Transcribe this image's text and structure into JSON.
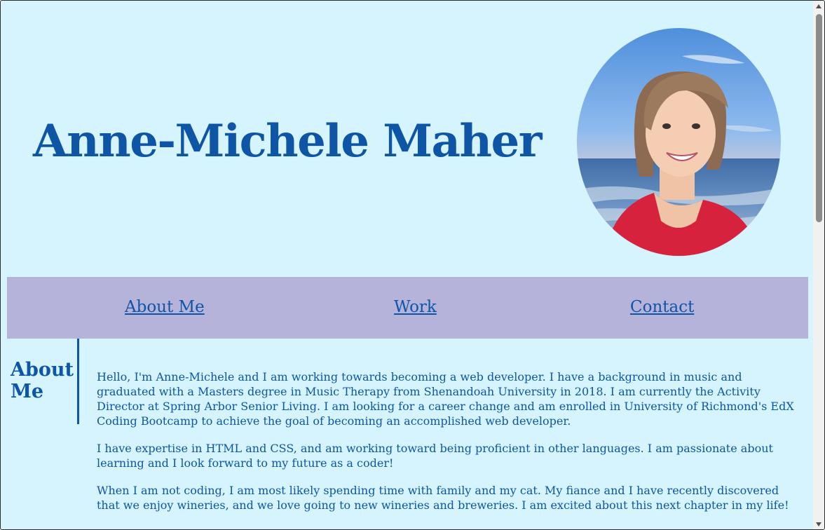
{
  "header": {
    "title": "Anne-Michele Maher",
    "portrait_icon": "portrait-photo"
  },
  "nav": {
    "items": [
      {
        "label": "About Me"
      },
      {
        "label": "Work"
      },
      {
        "label": "Contact"
      }
    ]
  },
  "about": {
    "heading": "About Me",
    "paragraphs": [
      "Hello, I'm Anne-Michele and I am working towards becoming a web developer. I have a background in music and graduated with a Masters degree in Music Therapy from Shenandoah University in 2018. I am currently the Activity Director at Spring Arbor Senior Living. I am looking for a career change and am enrolled in University of Richmond's EdX Coding Bootcamp to achieve the goal of becoming an accomplished web developer.",
      "I have expertise in HTML and CSS, and am working toward being proficient in other languages. I am passionate about learning and I look forward to my future as a coder!",
      "When I am not coding, I am most likely spending time with family and my cat. My fiance and I have recently discovered that we enjoy wineries, and we love going to new wineries and breweries. I am excited about this next chapter in my life!"
    ]
  },
  "colors": {
    "page_background": "#d5f4fd",
    "accent": "#0e55a6",
    "nav_background": "#b6b3db"
  },
  "scrollbar": {
    "up_icon": "scroll-up-arrow",
    "down_icon": "scroll-down-arrow"
  }
}
